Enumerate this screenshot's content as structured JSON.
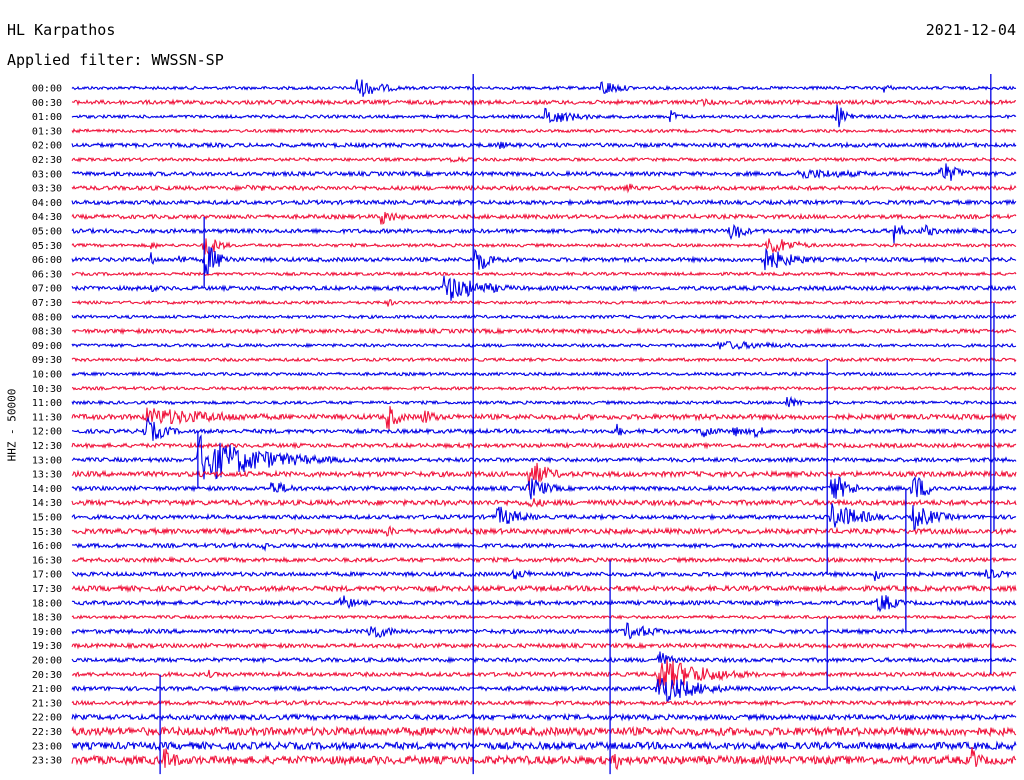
{
  "header": {
    "station": "HL Karpathos",
    "filter": "Applied filter: WWSSN-SP",
    "date": "2021-12-04",
    "channel": "HHZ - 50000"
  },
  "chart_data": {
    "type": "line",
    "title": "HL Karpathos",
    "subtitle": "Applied filter: WWSSN-SP",
    "ylabel": "HHZ - 50000",
    "date": "2021-12-04",
    "colors": {
      "even_rows": "#0000e6",
      "odd_rows": "#f0143c"
    },
    "y_tick_labels": [
      "00:00",
      "00:30",
      "01:00",
      "01:30",
      "02:00",
      "02:30",
      "03:00",
      "03:30",
      "04:00",
      "04:30",
      "05:00",
      "05:30",
      "06:00",
      "06:30",
      "07:00",
      "07:30",
      "08:00",
      "08:30",
      "09:00",
      "09:30",
      "10:00",
      "10:30",
      "11:00",
      "11:30",
      "12:00",
      "12:30",
      "13:00",
      "13:30",
      "14:00",
      "14:30",
      "15:00",
      "15:30",
      "16:00",
      "16:30",
      "17:00",
      "17:30",
      "18:00",
      "18:30",
      "19:00",
      "19:30",
      "20:00",
      "20:30",
      "21:00",
      "21:30",
      "22:00",
      "22:30",
      "23:00",
      "23:30"
    ],
    "x_range_minutes": [
      0,
      30
    ],
    "noise_amplitude": [
      1.5,
      2,
      1.5,
      1.5,
      2,
      1.5,
      2,
      2,
      2,
      2,
      2,
      1.5,
      2,
      1.5,
      2,
      1.5,
      1.5,
      2,
      1.5,
      1.5,
      1.5,
      1.5,
      1.5,
      2.5,
      2,
      2,
      2,
      2.5,
      2,
      2.5,
      2,
      2.5,
      2,
      2,
      2,
      2.5,
      2,
      1.5,
      2,
      2,
      2,
      2,
      2,
      2,
      2.5,
      4,
      3.5,
      4
    ],
    "events": [
      {
        "row": 0,
        "t": 9.0,
        "amp": 12,
        "dur": 0.8
      },
      {
        "row": 0,
        "t": 16.8,
        "amp": 10,
        "dur": 0.6
      },
      {
        "row": 0,
        "t": 25.8,
        "amp": 5,
        "dur": 0.3
      },
      {
        "row": 1,
        "t": 20.0,
        "amp": 4,
        "dur": 0.8
      },
      {
        "row": 2,
        "t": 15.0,
        "amp": 10,
        "dur": 1.0
      },
      {
        "row": 2,
        "t": 19.0,
        "amp": 8,
        "dur": 0.3
      },
      {
        "row": 2,
        "t": 24.3,
        "amp": 14,
        "dur": 0.4
      },
      {
        "row": 4,
        "t": 13.5,
        "amp": 5,
        "dur": 0.5
      },
      {
        "row": 5,
        "t": 12.0,
        "amp": 4,
        "dur": 0.8
      },
      {
        "row": 6,
        "t": 23.0,
        "amp": 6,
        "dur": 2.5
      },
      {
        "row": 6,
        "t": 27.6,
        "amp": 14,
        "dur": 0.6
      },
      {
        "row": 7,
        "t": 17.6,
        "amp": 8,
        "dur": 0.3
      },
      {
        "row": 7,
        "t": 5.5,
        "amp": 4,
        "dur": 1.5
      },
      {
        "row": 9,
        "t": 9.8,
        "amp": 10,
        "dur": 0.5
      },
      {
        "row": 10,
        "t": 20.9,
        "amp": 15,
        "dur": 0.4
      },
      {
        "row": 10,
        "t": 26.1,
        "amp": 14,
        "dur": 0.3
      },
      {
        "row": 10,
        "t": 27.0,
        "amp": 8,
        "dur": 0.5
      },
      {
        "row": 11,
        "t": 4.2,
        "amp": 16,
        "dur": 0.4
      },
      {
        "row": 11,
        "t": 2.5,
        "amp": 6,
        "dur": 0.2
      },
      {
        "row": 11,
        "t": 22.1,
        "amp": 12,
        "dur": 0.8
      },
      {
        "row": 12,
        "t": 2.5,
        "amp": 8,
        "dur": 0.2
      },
      {
        "row": 12,
        "t": 3.4,
        "amp": 8,
        "dur": 0.2
      },
      {
        "row": 12,
        "t": 4.2,
        "amp": 20,
        "dur": 0.5
      },
      {
        "row": 12,
        "t": 12.8,
        "amp": 16,
        "dur": 0.5
      },
      {
        "row": 12,
        "t": 21.9,
        "amp": 14,
        "dur": 1.0
      },
      {
        "row": 14,
        "t": 11.8,
        "amp": 16,
        "dur": 1.2
      },
      {
        "row": 14,
        "t": 2.5,
        "amp": 4,
        "dur": 0.5
      },
      {
        "row": 15,
        "t": 10.0,
        "amp": 5,
        "dur": 0.3
      },
      {
        "row": 18,
        "t": 20.5,
        "amp": 5,
        "dur": 2.5
      },
      {
        "row": 22,
        "t": 22.7,
        "amp": 8,
        "dur": 0.4
      },
      {
        "row": 23,
        "t": 2.3,
        "amp": 10,
        "dur": 3.0
      },
      {
        "row": 23,
        "t": 10.0,
        "amp": 16,
        "dur": 0.4
      },
      {
        "row": 23,
        "t": 11.1,
        "amp": 10,
        "dur": 0.5
      },
      {
        "row": 24,
        "t": 2.3,
        "amp": 16,
        "dur": 0.6
      },
      {
        "row": 24,
        "t": 17.3,
        "amp": 8,
        "dur": 0.3
      },
      {
        "row": 24,
        "t": 20.0,
        "amp": 10,
        "dur": 0.4
      },
      {
        "row": 24,
        "t": 21.0,
        "amp": 6,
        "dur": 0.6
      },
      {
        "row": 24,
        "t": 21.7,
        "amp": 8,
        "dur": 0.3
      },
      {
        "row": 26,
        "t": 4.0,
        "amp": 26,
        "dur": 2.0
      },
      {
        "row": 27,
        "t": 14.5,
        "amp": 18,
        "dur": 0.6
      },
      {
        "row": 28,
        "t": 6.3,
        "amp": 8,
        "dur": 0.8
      },
      {
        "row": 28,
        "t": 14.5,
        "amp": 14,
        "dur": 0.6
      },
      {
        "row": 28,
        "t": 24.1,
        "amp": 18,
        "dur": 0.6
      },
      {
        "row": 28,
        "t": 26.7,
        "amp": 18,
        "dur": 0.5
      },
      {
        "row": 29,
        "t": 14.5,
        "amp": 6,
        "dur": 0.8
      },
      {
        "row": 30,
        "t": 13.5,
        "amp": 12,
        "dur": 0.8
      },
      {
        "row": 30,
        "t": 24.1,
        "amp": 16,
        "dur": 1.0
      },
      {
        "row": 30,
        "t": 26.7,
        "amp": 14,
        "dur": 0.8
      },
      {
        "row": 31,
        "t": 10.0,
        "amp": 6,
        "dur": 0.5
      },
      {
        "row": 32,
        "t": 6.0,
        "amp": 8,
        "dur": 0.3
      },
      {
        "row": 34,
        "t": 14.0,
        "amp": 6,
        "dur": 0.8
      },
      {
        "row": 34,
        "t": 25.5,
        "amp": 8,
        "dur": 0.3
      },
      {
        "row": 34,
        "t": 29.0,
        "amp": 6,
        "dur": 0.8
      },
      {
        "row": 36,
        "t": 8.5,
        "amp": 10,
        "dur": 0.5
      },
      {
        "row": 36,
        "t": 25.6,
        "amp": 14,
        "dur": 0.5
      },
      {
        "row": 38,
        "t": 9.4,
        "amp": 10,
        "dur": 0.8
      },
      {
        "row": 38,
        "t": 17.5,
        "amp": 10,
        "dur": 1.0
      },
      {
        "row": 40,
        "t": 18.6,
        "amp": 12,
        "dur": 0.4
      },
      {
        "row": 41,
        "t": 18.6,
        "amp": 20,
        "dur": 1.5
      },
      {
        "row": 41,
        "t": 4.3,
        "amp": 6,
        "dur": 0.2
      },
      {
        "row": 42,
        "t": 18.6,
        "amp": 18,
        "dur": 1.2
      },
      {
        "row": 47,
        "t": 2.9,
        "amp": 14,
        "dur": 0.5
      },
      {
        "row": 47,
        "t": 17.2,
        "amp": 14,
        "dur": 0.3
      },
      {
        "row": 47,
        "t": 28.6,
        "amp": 14,
        "dur": 0.3
      }
    ],
    "spikes": [
      {
        "t": 12.75,
        "row_start": 0,
        "row_end": 47
      },
      {
        "t": 29.2,
        "row_start": 0,
        "row_end": 40
      },
      {
        "t": 29.3,
        "row_start": 16,
        "row_end": 30
      },
      {
        "t": 4.2,
        "row_start": 10,
        "row_end": 13
      },
      {
        "t": 4.0,
        "row_start": 25,
        "row_end": 27
      },
      {
        "t": 24.0,
        "row_start": 20,
        "row_end": 33
      },
      {
        "t": 26.5,
        "row_start": 29,
        "row_end": 34
      },
      {
        "t": 17.1,
        "row_start": 34,
        "row_end": 47
      },
      {
        "t": 26.5,
        "row_start": 35,
        "row_end": 37
      },
      {
        "t": 2.8,
        "row_start": 42,
        "row_end": 47
      },
      {
        "t": 24.0,
        "row_start": 38,
        "row_end": 41
      }
    ]
  }
}
